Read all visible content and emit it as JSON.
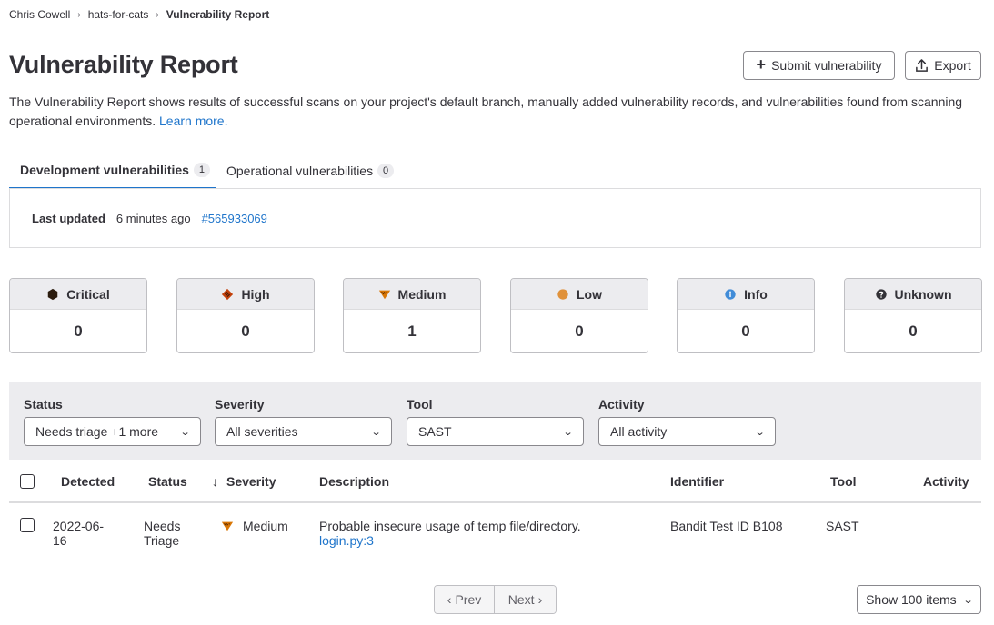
{
  "breadcrumb": [
    "Chris Cowell",
    "hats-for-cats",
    "Vulnerability Report"
  ],
  "page_title": "Vulnerability Report",
  "actions": {
    "submit_label": "Submit vulnerability",
    "export_label": "Export"
  },
  "description": {
    "text": "The Vulnerability Report shows results of successful scans on your project's default branch, manually added vulnerability records, and vulnerabilities found from scanning operational environments.",
    "link": "Learn more."
  },
  "tabs": [
    {
      "label": "Development vulnerabilities",
      "count": "1",
      "active": true
    },
    {
      "label": "Operational vulnerabilities",
      "count": "0",
      "active": false
    }
  ],
  "last_updated": {
    "label": "Last updated",
    "time": "6 minutes ago",
    "pipeline": "#565933069"
  },
  "severity_counts": [
    {
      "label": "Critical",
      "count": "0",
      "icon": "severity-critical-icon",
      "color": "#2b1c0e"
    },
    {
      "label": "High",
      "count": "0",
      "icon": "severity-high-icon",
      "color": "#c2410c"
    },
    {
      "label": "Medium",
      "count": "1",
      "icon": "severity-medium-icon",
      "color": "#d97706"
    },
    {
      "label": "Low",
      "count": "0",
      "icon": "severity-low-icon",
      "color": "#e9a34b"
    },
    {
      "label": "Info",
      "count": "0",
      "icon": "severity-info-icon",
      "color": "#418cd8"
    },
    {
      "label": "Unknown",
      "count": "0",
      "icon": "severity-unknown-icon",
      "color": "#333238"
    }
  ],
  "filters": {
    "status": {
      "label": "Status",
      "value": "Needs triage +1 more"
    },
    "severity": {
      "label": "Severity",
      "value": "All severities"
    },
    "tool": {
      "label": "Tool",
      "value": "SAST"
    },
    "activity": {
      "label": "Activity",
      "value": "All activity"
    }
  },
  "table": {
    "headers": {
      "detected": "Detected",
      "status": "Status",
      "severity": "Severity",
      "description": "Description",
      "identifier": "Identifier",
      "tool": "Tool",
      "activity": "Activity"
    },
    "rows": [
      {
        "detected_line1": "2022-06-",
        "detected_line2": "16",
        "status_line1": "Needs",
        "status_line2": "Triage",
        "severity": "Medium",
        "description": "Probable insecure usage of temp file/directory.",
        "location": "login.py:3",
        "identifier": "Bandit Test ID B108",
        "tool": "SAST",
        "activity": ""
      }
    ]
  },
  "pagination": {
    "prev": "Prev",
    "next": "Next",
    "page_size": "Show 100 items"
  }
}
